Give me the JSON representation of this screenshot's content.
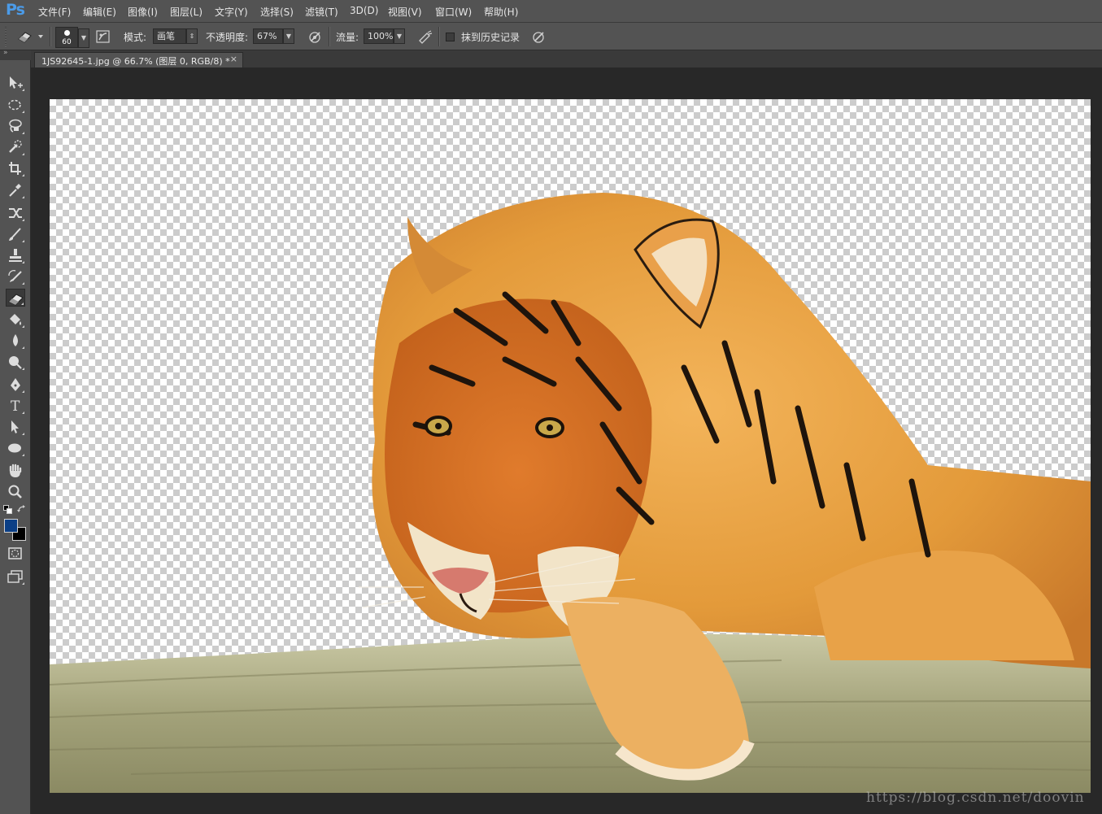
{
  "app": {
    "logo": "Ps",
    "menu": [
      {
        "id": "file",
        "label": "文件(F)"
      },
      {
        "id": "edit",
        "label": "编辑(E)"
      },
      {
        "id": "image",
        "label": "图像(I)"
      },
      {
        "id": "layer",
        "label": "图层(L)"
      },
      {
        "id": "type",
        "label": "文字(Y)"
      },
      {
        "id": "select",
        "label": "选择(S)"
      },
      {
        "id": "filter",
        "label": "滤镜(T)"
      },
      {
        "id": "3d",
        "label": "3D(D)"
      },
      {
        "id": "view",
        "label": "视图(V)"
      },
      {
        "id": "window",
        "label": "窗口(W)"
      },
      {
        "id": "help",
        "label": "帮助(H)"
      }
    ]
  },
  "options": {
    "brush_size": "60",
    "mode_label": "模式:",
    "mode_value": "画笔",
    "opacity_label": "不透明度:",
    "opacity_value": "67%",
    "flow_label": "流量:",
    "flow_value": "100%",
    "erase_history_label": "抹到历史记录",
    "erase_history_checked": false
  },
  "toolbar": {
    "tools": [
      "move",
      "elliptical-marquee",
      "lasso",
      "quick-selection",
      "crop",
      "eyedropper",
      "healing-brush",
      "brush",
      "clone-stamp",
      "history-brush",
      "eraser",
      "paint-bucket",
      "blur",
      "dodge",
      "pen",
      "type",
      "path-selection",
      "ellipse",
      "hand",
      "zoom"
    ],
    "active_tool": "eraser",
    "foreground_color": "#0b3f86",
    "background_color": "#000000"
  },
  "document": {
    "tab_label": "1JS92645-1.jpg @ 66.7% (图层 0, RGB/8) *",
    "close": "×"
  },
  "watermark": "https://blog.csdn.net/doovin"
}
